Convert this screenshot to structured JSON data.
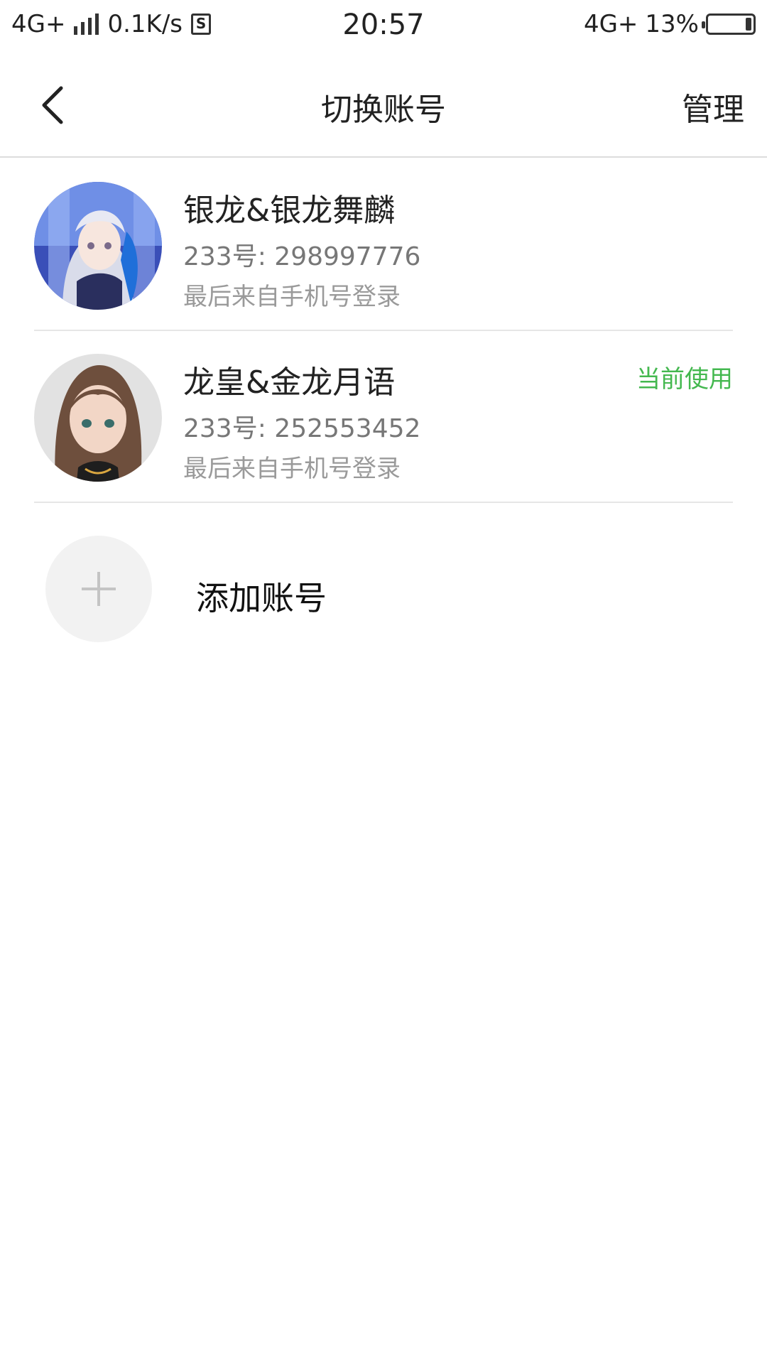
{
  "status_bar": {
    "network": "4G+",
    "speed": "0.1K/s",
    "sim_icon": "S",
    "time": "20:57",
    "network_right": "4G+",
    "battery": "13%",
    "battery_level": 0.13
  },
  "header": {
    "title": "切换账号",
    "manage": "管理",
    "back_icon": "chevron-left-icon"
  },
  "accounts": [
    {
      "name": "银龙&银龙舞麟",
      "id": "233号: 298997776",
      "login": "最后来自手机号登录",
      "current": ""
    },
    {
      "name": "龙皇&金龙月语",
      "id": "233号: 252553452",
      "login": "最后来自手机号登录",
      "current": "当前使用"
    }
  ],
  "add": {
    "label": "添加账号",
    "icon": "plus-icon"
  },
  "colors": {
    "accent_green": "#44b84f",
    "divider": "#e6e6e6"
  }
}
